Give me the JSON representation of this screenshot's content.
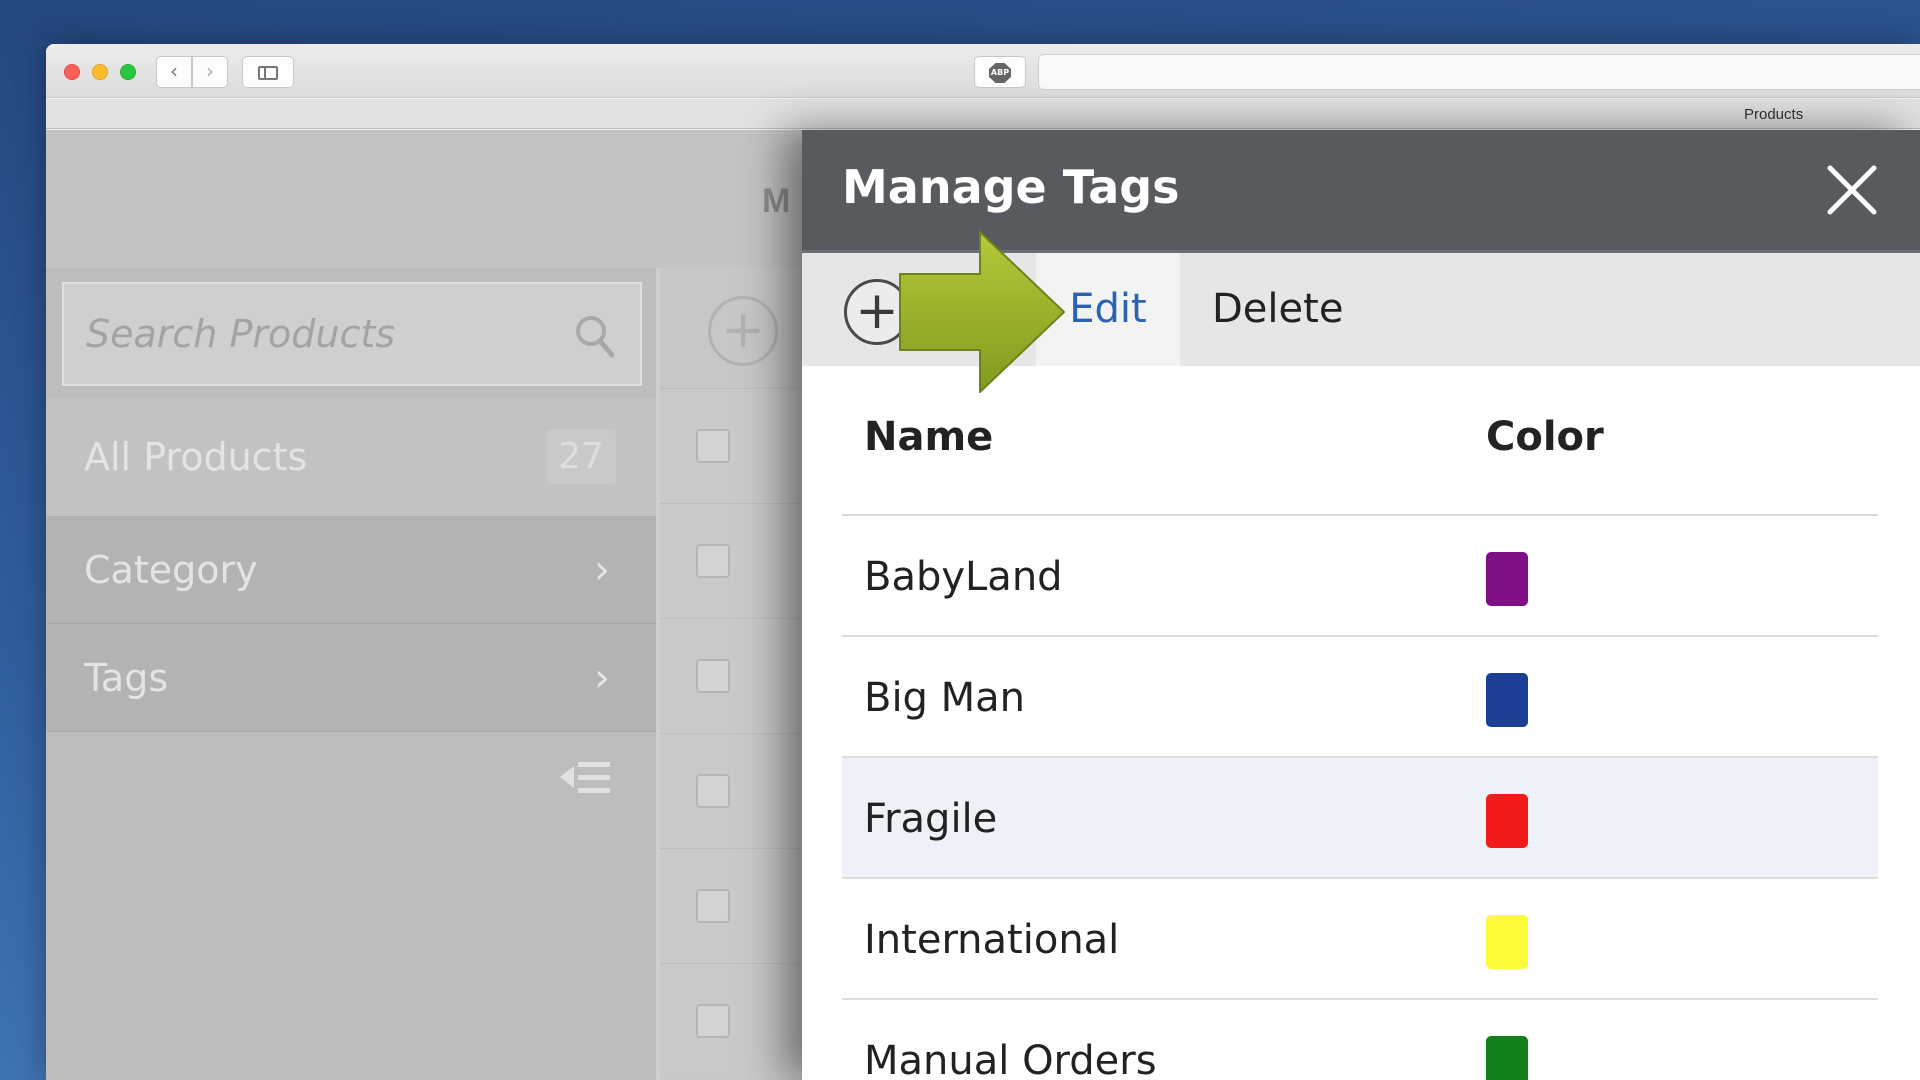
{
  "browser": {
    "tab_title": "Products",
    "abp_label": "ABP"
  },
  "app": {
    "header_title": "M",
    "sidebar": {
      "search_placeholder": "Search Products",
      "items": [
        {
          "label": "All Products",
          "count": "27"
        },
        {
          "label": "Category"
        },
        {
          "label": "Tags"
        }
      ]
    },
    "list_row_prefix": "0"
  },
  "modal": {
    "title": "Manage Tags",
    "toolbar": {
      "add_label": "+",
      "edit_label": "Edit",
      "delete_label": "Delete"
    },
    "table": {
      "columns": [
        "Name",
        "Color"
      ],
      "rows": [
        {
          "name": "BabyLand",
          "color": "#7e0f86"
        },
        {
          "name": "Big Man",
          "color": "#1d3f96"
        },
        {
          "name": "Fragile",
          "color": "#f31a1a",
          "highlighted": true
        },
        {
          "name": "International",
          "color": "#fbfb3a"
        },
        {
          "name": "Manual Orders",
          "color": "#12801a"
        }
      ]
    }
  },
  "icons": {
    "close": "close-icon",
    "search": "search-icon",
    "collapse": "collapse-sidebar-icon",
    "arrow": "arrow-right-icon"
  }
}
